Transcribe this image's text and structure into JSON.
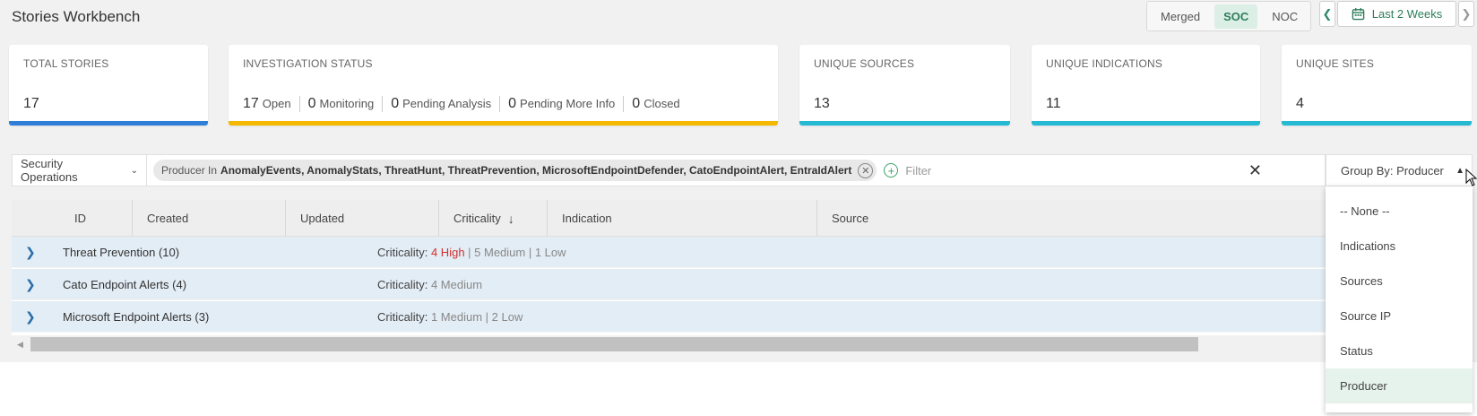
{
  "header": {
    "title": "Stories Workbench",
    "modes": [
      {
        "label": "Merged",
        "active": false
      },
      {
        "label": "SOC",
        "active": true
      },
      {
        "label": "NOC",
        "active": false
      }
    ],
    "date_range": "Last 2 Weeks"
  },
  "cards": {
    "total_stories": {
      "label": "TOTAL STORIES",
      "value": "17",
      "color": "#2f7ed8"
    },
    "investigation": {
      "label": "INVESTIGATION STATUS",
      "color": "#f5b800",
      "items": [
        {
          "num": "17",
          "label": "Open"
        },
        {
          "num": "0",
          "label": "Monitoring"
        },
        {
          "num": "0",
          "label": "Pending Analysis"
        },
        {
          "num": "0",
          "label": "Pending More Info"
        },
        {
          "num": "0",
          "label": "Closed"
        }
      ]
    },
    "unique_sources": {
      "label": "UNIQUE SOURCES",
      "value": "13",
      "color": "#26b9d3"
    },
    "unique_indications": {
      "label": "UNIQUE INDICATIONS",
      "value": "11",
      "color": "#26b9d3"
    },
    "unique_sites": {
      "label": "UNIQUE SITES",
      "value": "4",
      "color": "#26b9d3"
    }
  },
  "filter": {
    "scope": "Security Operations",
    "chip_prefix": "Producer In",
    "chip_values": "AnomalyEvents, AnomalyStats, ThreatHunt, ThreatPrevention, MicrosoftEndpointDefender, CatoEndpointAlert, EntraIdAlert",
    "placeholder": "Filter"
  },
  "group_by": {
    "label": "Group By: Producer",
    "options": [
      "-- None --",
      "Indications",
      "Sources",
      "Source IP",
      "Status",
      "Producer"
    ],
    "selected": "Producer"
  },
  "table": {
    "columns": [
      "ID",
      "Created",
      "Updated",
      "Criticality",
      "Indication",
      "Source"
    ],
    "sort_column": "Criticality",
    "groups": [
      {
        "name": "Threat Prevention (10)",
        "crit_label": "Criticality:",
        "high": "4 High",
        "rest": " | 5 Medium | 1 Low"
      },
      {
        "name": "Cato Endpoint Alerts (4)",
        "crit_label": "Criticality:",
        "high": "",
        "rest": "4 Medium"
      },
      {
        "name": "Microsoft Endpoint Alerts (3)",
        "crit_label": "Criticality:",
        "high": "",
        "rest": "1 Medium | 2 Low"
      }
    ]
  }
}
